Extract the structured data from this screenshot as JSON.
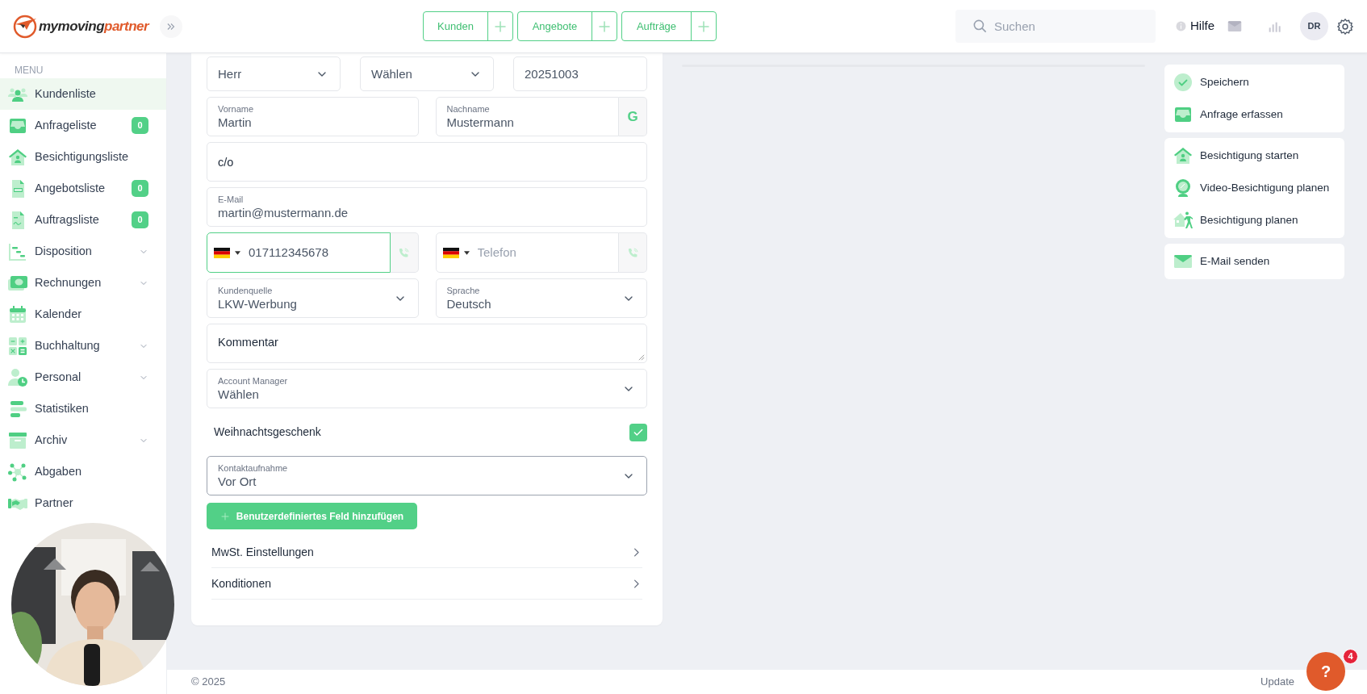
{
  "header": {
    "logo": {
      "first": "mymoving",
      "second": "partner"
    },
    "quick_actions": [
      {
        "label": "Kunden"
      },
      {
        "label": "Angebote"
      },
      {
        "label": "Aufträge"
      }
    ],
    "search": {
      "placeholder": "Suchen"
    },
    "help": "Hilfe",
    "avatar": "DR"
  },
  "sidebar": {
    "heading": "MENU",
    "items": [
      {
        "label": "Kundenliste",
        "selected": true,
        "expandable": false
      },
      {
        "label": "Anfrageliste",
        "selected": false,
        "expandable": false,
        "badge": "0"
      },
      {
        "label": "Besichtigungsliste",
        "selected": false,
        "expandable": false
      },
      {
        "label": "Angebotsliste",
        "selected": false,
        "expandable": false,
        "badge": "0"
      },
      {
        "label": "Auftragsliste",
        "selected": false,
        "expandable": false,
        "badge": "0"
      },
      {
        "label": "Disposition",
        "selected": false,
        "expandable": true
      },
      {
        "label": "Rechnungen",
        "selected": false,
        "expandable": true
      },
      {
        "label": "Kalender",
        "selected": false,
        "expandable": false
      },
      {
        "label": "Buchhaltung",
        "selected": false,
        "expandable": true
      },
      {
        "label": "Personal",
        "selected": false,
        "expandable": true
      },
      {
        "label": "Statistiken",
        "selected": false,
        "expandable": false
      },
      {
        "label": "Archiv",
        "selected": false,
        "expandable": true
      },
      {
        "label": "Abgaben",
        "selected": false,
        "expandable": false
      },
      {
        "label": "Partner",
        "selected": false,
        "expandable": false
      }
    ]
  },
  "form": {
    "rows": [
      [
        {
          "kind": "select",
          "value": "Herr",
          "focused": false
        },
        {
          "kind": "select",
          "value": "Wählen",
          "focused": false
        },
        {
          "kind": "text",
          "value": "20251003",
          "focused": false
        }
      ],
      [
        {
          "kind": "text",
          "label": "Vorname",
          "value": "Martin",
          "focused": false
        },
        {
          "kind": "text",
          "label": "Nachname",
          "value": "Mustermann",
          "focused": false,
          "addon": "G"
        }
      ],
      [
        {
          "kind": "text",
          "placeholder": "c/o",
          "focused": false
        }
      ],
      [
        {
          "kind": "text",
          "label": "E-Mail",
          "value": "martin@mustermann.de",
          "focused": false
        }
      ],
      [
        {
          "kind": "phone",
          "value": "017112345678",
          "focused": true
        },
        {
          "kind": "phone",
          "placeholder": "Telefon",
          "focused": false
        }
      ],
      [
        {
          "kind": "select",
          "label": "Kundenquelle",
          "value": "LKW-Werbung",
          "focused": false
        },
        {
          "kind": "select",
          "label": "Sprache",
          "value": "Deutsch",
          "focused": false
        }
      ],
      [
        {
          "kind": "textarea",
          "placeholder": "Kommentar",
          "focused": false
        }
      ],
      [
        {
          "kind": "select",
          "label": "Account Manager",
          "value": "Wählen",
          "focused": false
        }
      ],
      [
        {
          "kind": "checkbox",
          "label": "Weihnachtsgeschenk",
          "checked": true
        }
      ],
      [
        {
          "kind": "select",
          "label": "Kontaktaufnahme",
          "value": "Vor Ort",
          "focused": true
        }
      ]
    ],
    "add_button": "Benutzerdefiniertes Feld hinzufügen",
    "sections": [
      {
        "label": "MwSt. Einstellungen"
      },
      {
        "label": "Konditionen"
      }
    ]
  },
  "actions": [
    [
      {
        "label": "Speichern"
      },
      {
        "label": "Anfrage erfassen"
      }
    ],
    [
      {
        "label": "Besichtigung starten"
      },
      {
        "label": "Video-Besichtigung planen"
      },
      {
        "label": "Besichtigung planen"
      }
    ],
    [
      {
        "label": "E-Mail senden"
      }
    ]
  ],
  "footer": {
    "copyright": "© 2025",
    "update": "Update"
  },
  "help_button": {
    "label": "?",
    "badge": "4"
  }
}
